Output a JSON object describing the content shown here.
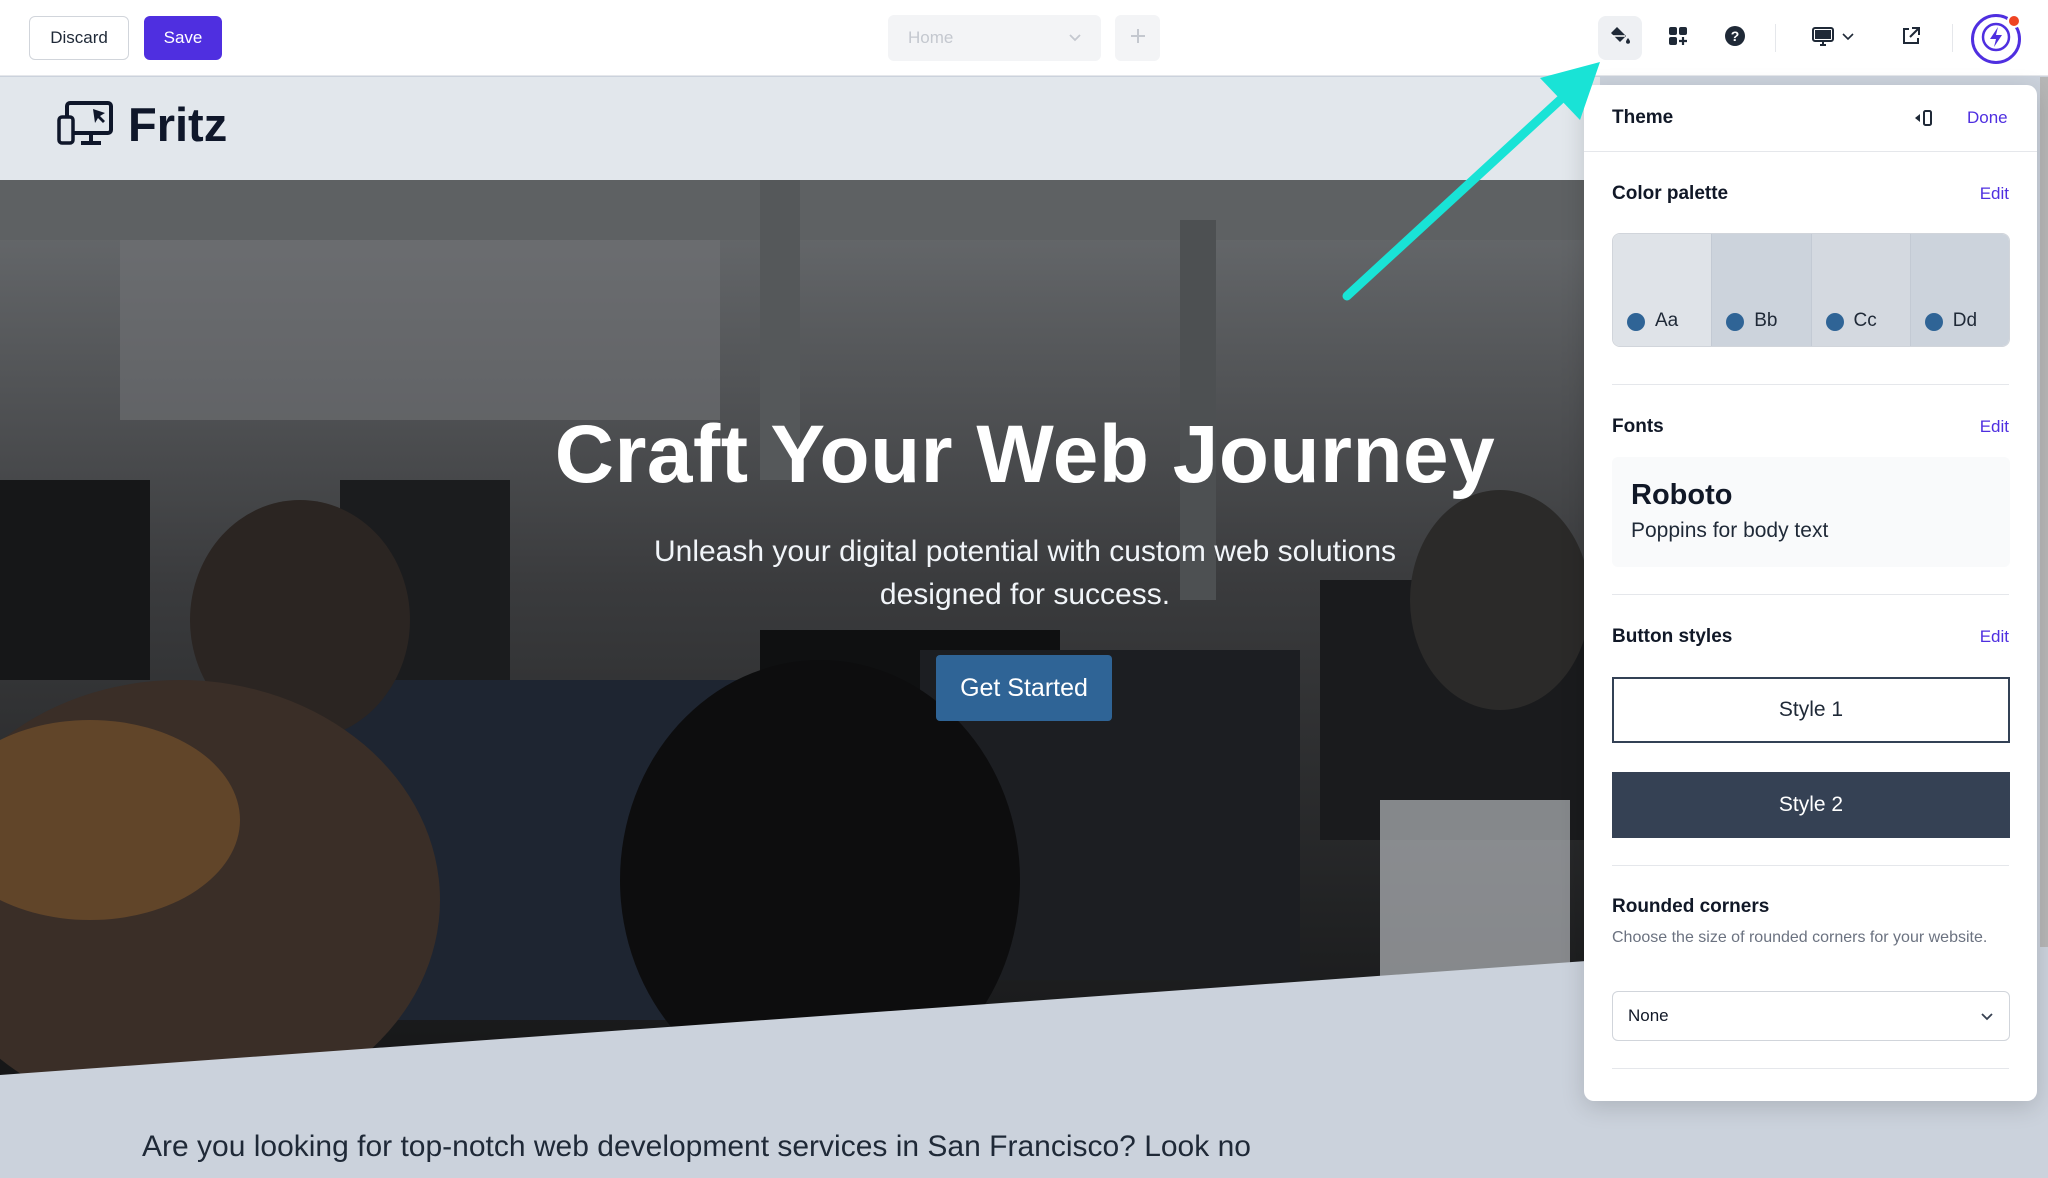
{
  "toolbar": {
    "discard_label": "Discard",
    "save_label": "Save",
    "page_select_value": "Home",
    "add_page_icon": "plus-icon",
    "tools": [
      "paint-bucket-icon",
      "add-section-icon",
      "help-icon",
      "desktop-icon",
      "external-link-icon",
      "lightning-icon"
    ]
  },
  "site": {
    "logo_text": "Fritz",
    "hero": {
      "title": "Craft Your Web Journey",
      "subtitle": "Unleash your digital potential with custom web solutions designed for success.",
      "cta_label": "Get Started"
    },
    "intro_text": "Are you looking for top-notch web development services in San Francisco? Look no"
  },
  "panel": {
    "title": "Theme",
    "done_label": "Done",
    "color_palette": {
      "title": "Color palette",
      "edit_label": "Edit",
      "swatches": [
        {
          "label": "Aa",
          "bg": "#dfe3e8"
        },
        {
          "label": "Bb",
          "bg": "#ccd3dc"
        },
        {
          "label": "Cc",
          "bg": "#d4d9e0"
        },
        {
          "label": "Dd",
          "bg": "#ccd3dc"
        }
      ],
      "dot_color": "#2f6496"
    },
    "fonts": {
      "title": "Fonts",
      "edit_label": "Edit",
      "heading_font": "Roboto",
      "body_text": "Poppins for body text"
    },
    "button_styles": {
      "title": "Button styles",
      "edit_label": "Edit",
      "style1_label": "Style 1",
      "style2_label": "Style 2"
    },
    "rounded_corners": {
      "title": "Rounded corners",
      "description": "Choose the size of rounded corners for your website.",
      "selected": "None"
    }
  },
  "colors": {
    "accent": "#4f2fe0",
    "brand_blue": "#2f6496",
    "annotation_arrow": "#19e3d6",
    "notification_dot": "#ef4423"
  }
}
